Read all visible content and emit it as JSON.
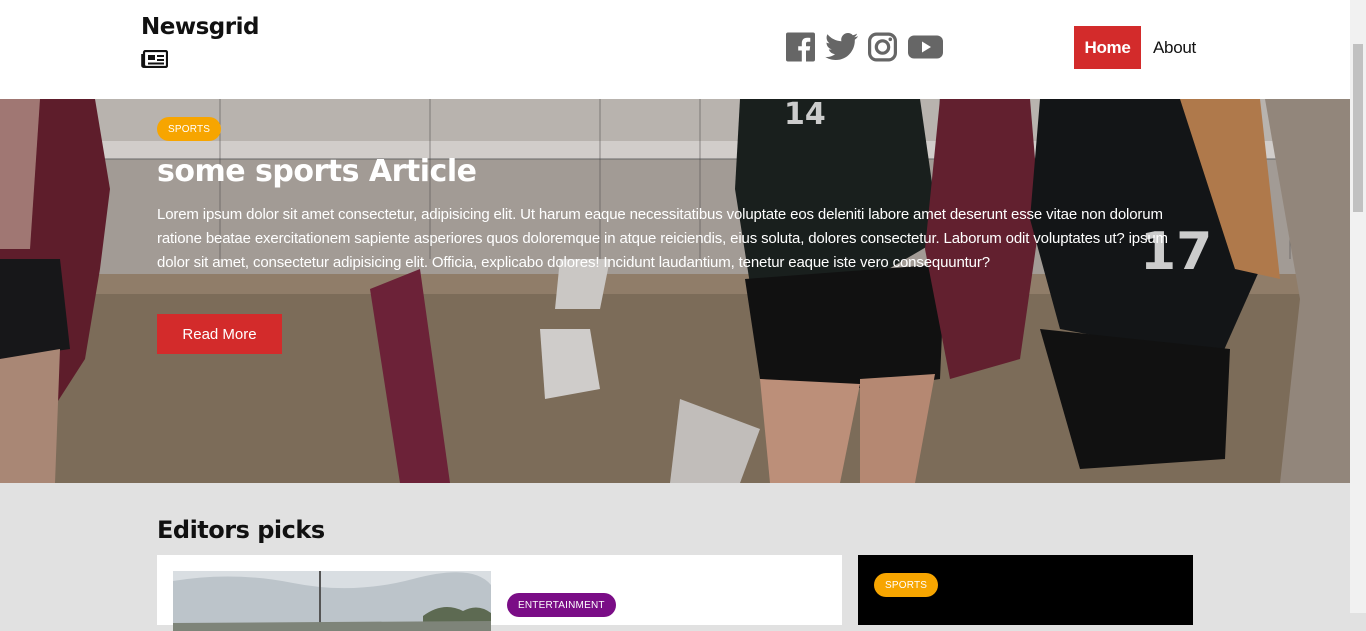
{
  "header": {
    "logo_text": "Newsgrid",
    "logo_icon": "newspaper-icon",
    "social_icons": [
      "facebook-icon",
      "twitter-icon",
      "instagram-icon",
      "youtube-icon"
    ],
    "nav": [
      {
        "label": "Home",
        "active": true
      },
      {
        "label": "About",
        "active": false
      }
    ],
    "accent_color": "#d32b2b"
  },
  "hero": {
    "category": "SPORTS",
    "title": "some sports Article",
    "text": "Lorem ipsum dolor sit amet consectetur, adipisicing elit. Ut harum eaque necessitatibus voluptate eos deleniti labore amet deserunt esse vitae non dolorum ratione beatae exercitationem sapiente asperiores quos doloremque in atque reiciendis, eius soluta, dolores consectetur. Laborum odit voluptates ut? ipsum dolor sit amet, consectetur adipisicing elit. Officia, explicabo dolores! Incidunt laudantium, tenetur eaque iste vero consequuntur?",
    "button": "Read More",
    "category_color": "#f7a500"
  },
  "editors_picks": {
    "title": "Editors picks",
    "main_card": {
      "category": "ENTERTAINMENT",
      "category_color": "#7a0d86"
    },
    "side_card": {
      "category": "SPORTS",
      "category_color": "#f7a500"
    }
  }
}
